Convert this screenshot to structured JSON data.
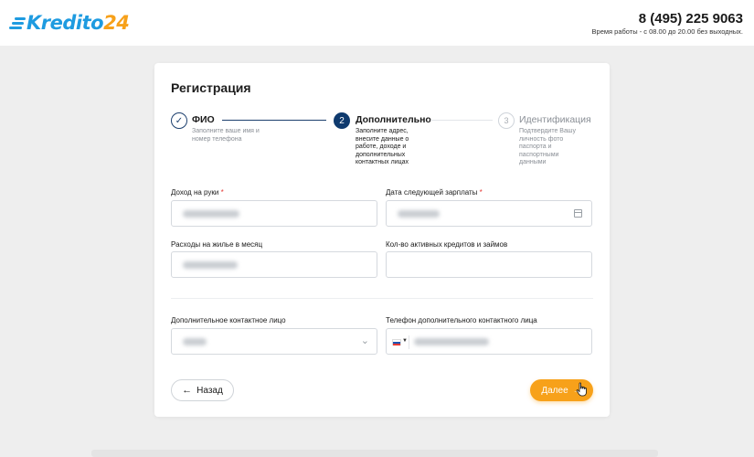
{
  "header": {
    "logo_text": "Kredito",
    "logo_number": "24",
    "phone": "8 (495) 225 9063",
    "hours": "Время работы - с 08.00 до 20.00 без выходных."
  },
  "card": {
    "title": "Регистрация"
  },
  "steps": [
    {
      "number": "✓",
      "title": "ФИО",
      "desc": "Заполните ваше имя и номер телефона",
      "state": "done"
    },
    {
      "number": "2",
      "title": "Дополнительно",
      "desc": "Заполните адрес, внесите данные о работе, доходе и дополнительных контактных лицах",
      "state": "active"
    },
    {
      "number": "3",
      "title": "Идентификация",
      "desc": "Подтвердите Вашу личность фото паспорта и паспортными данными",
      "state": "pending"
    }
  ],
  "form": {
    "income_label": "Доход на руки",
    "salary_date_label": "Дата следующей зарплаты",
    "housing_label": "Расходы на жилье в месяц",
    "loans_label": "Кол-во активных кредитов и займов",
    "contact_label": "Дополнительное контактное лицо",
    "contact_phone_label": "Телефон дополнительного контактного лица",
    "required_mark": "*"
  },
  "buttons": {
    "back": "Назад",
    "next": "Далее"
  },
  "colors": {
    "brand_blue": "#1e9be0",
    "brand_orange": "#f7a11a",
    "step_active": "#0f3a6e"
  }
}
